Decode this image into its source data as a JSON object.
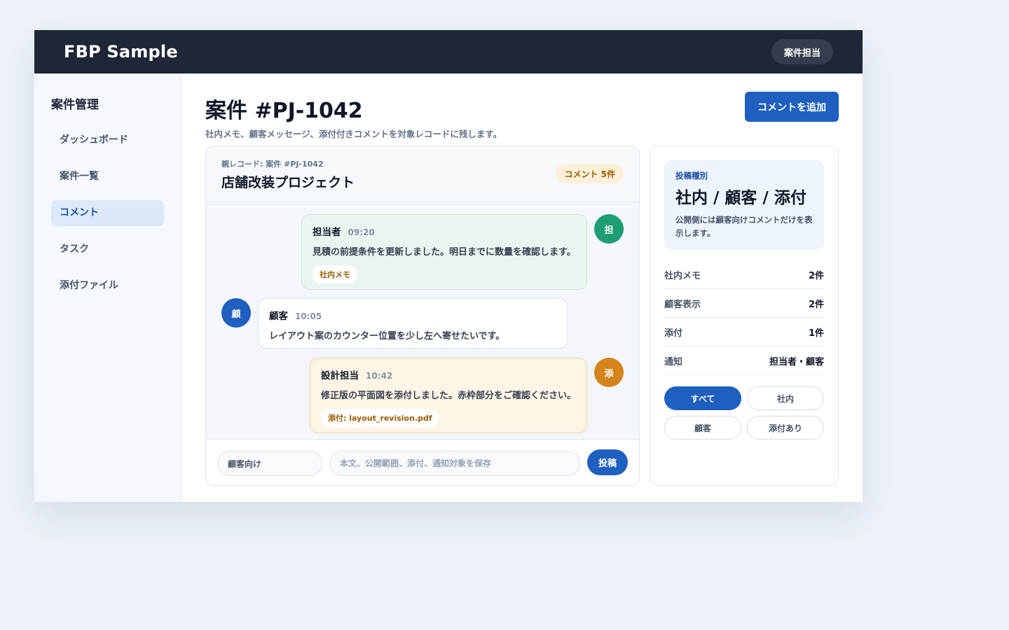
{
  "header": {
    "brand": "FBP Sample",
    "role": "案件担当"
  },
  "sidebar": {
    "title": "案件管理",
    "items": [
      {
        "label": "ダッシュボード",
        "active": false
      },
      {
        "label": "案件一覧",
        "active": false
      },
      {
        "label": "コメント",
        "active": true
      },
      {
        "label": "タスク",
        "active": false
      },
      {
        "label": "添付ファイル",
        "active": false
      }
    ]
  },
  "page": {
    "title": "案件 #PJ-1042",
    "subtitle": "社内メモ、顧客メッセージ、添付付きコメントを対象レコードに残します。",
    "add_button": "コメントを追加"
  },
  "thread": {
    "parent_label": "親レコード: 案件 #PJ-1042",
    "title": "店舗改装プロジェクト",
    "count_badge": "コメント 5件",
    "messages": [
      {
        "author": "担当者",
        "time": "09:20",
        "text": "見積の前提条件を更新しました。明日までに数量を確認します。",
        "tag": "社内メモ",
        "avatar": "担",
        "avatar_color": "#1f9e74"
      },
      {
        "author": "顧客",
        "time": "10:05",
        "text": "レイアウト案のカウンター位置を少し左へ寄せたいです。",
        "avatar": "顧",
        "avatar_color": "#1f5fbf"
      },
      {
        "author": "設計担当",
        "time": "10:42",
        "text": "修正版の平面図を添付しました。赤枠部分をご確認ください。",
        "tag": "添付: layout_revision.pdf",
        "avatar": "添",
        "avatar_color": "#d4841a"
      }
    ],
    "composer": {
      "scope": "顧客向け",
      "placeholder": "本文、公開範囲、添付、通知対象を保存",
      "post_button": "投稿"
    }
  },
  "panel": {
    "kind_label": "投稿種別",
    "kind_value": "社内 / 顧客 / 添付",
    "kind_desc": "公開側には顧客向けコメントだけを表示します。",
    "stats": [
      {
        "label": "社内メモ",
        "value": "2件"
      },
      {
        "label": "顧客表示",
        "value": "2件"
      },
      {
        "label": "添付",
        "value": "1件"
      },
      {
        "label": "通知",
        "value": "担当者・顧客"
      }
    ],
    "filters": [
      {
        "label": "すべて",
        "active": true
      },
      {
        "label": "社内",
        "active": false
      },
      {
        "label": "顧客",
        "active": false
      },
      {
        "label": "添付あり",
        "active": false
      }
    ]
  },
  "colors": {
    "primary": "#1f5fbf",
    "topbar": "#1e2637",
    "staff_bg": "#eaf5f0",
    "attach_bg": "#fff5e6"
  }
}
